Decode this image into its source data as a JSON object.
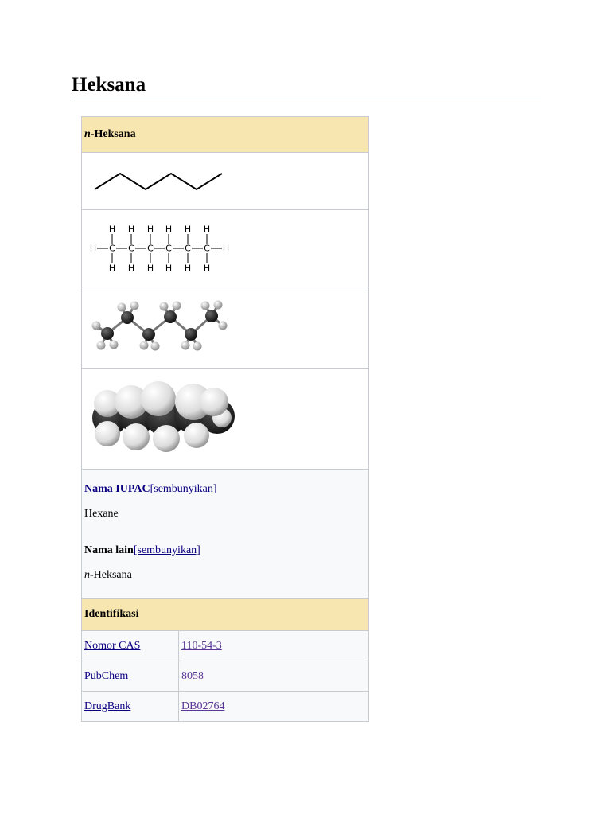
{
  "page": {
    "title": "Heksana"
  },
  "infobox": {
    "header_prefix": "n",
    "header_suffix": "-Heksana",
    "iupac_label": "Nama IUPAC",
    "iupac_toggle": "[sembunyikan]",
    "iupac_value": "Hexane",
    "other_label": "Nama lain",
    "other_toggle": "[sembunyikan]",
    "other_value_prefix": "n",
    "other_value_suffix": "-Heksana",
    "identification_header": "Identifikasi",
    "structural_atoms": {
      "carbon": "C",
      "hydrogen": "H"
    },
    "identifiers": [
      {
        "label": "Nomor CAS",
        "value": "110-54-3"
      },
      {
        "label": "PubChem",
        "value": "8058"
      },
      {
        "label": "DrugBank",
        "value": "DB02764"
      }
    ]
  },
  "colors": {
    "header_bg": "#f8e6b0",
    "link": "#0b0080",
    "visited_link": "#5a3696",
    "cell_bg": "#f8f9fa",
    "border": "#c8ccd1"
  }
}
